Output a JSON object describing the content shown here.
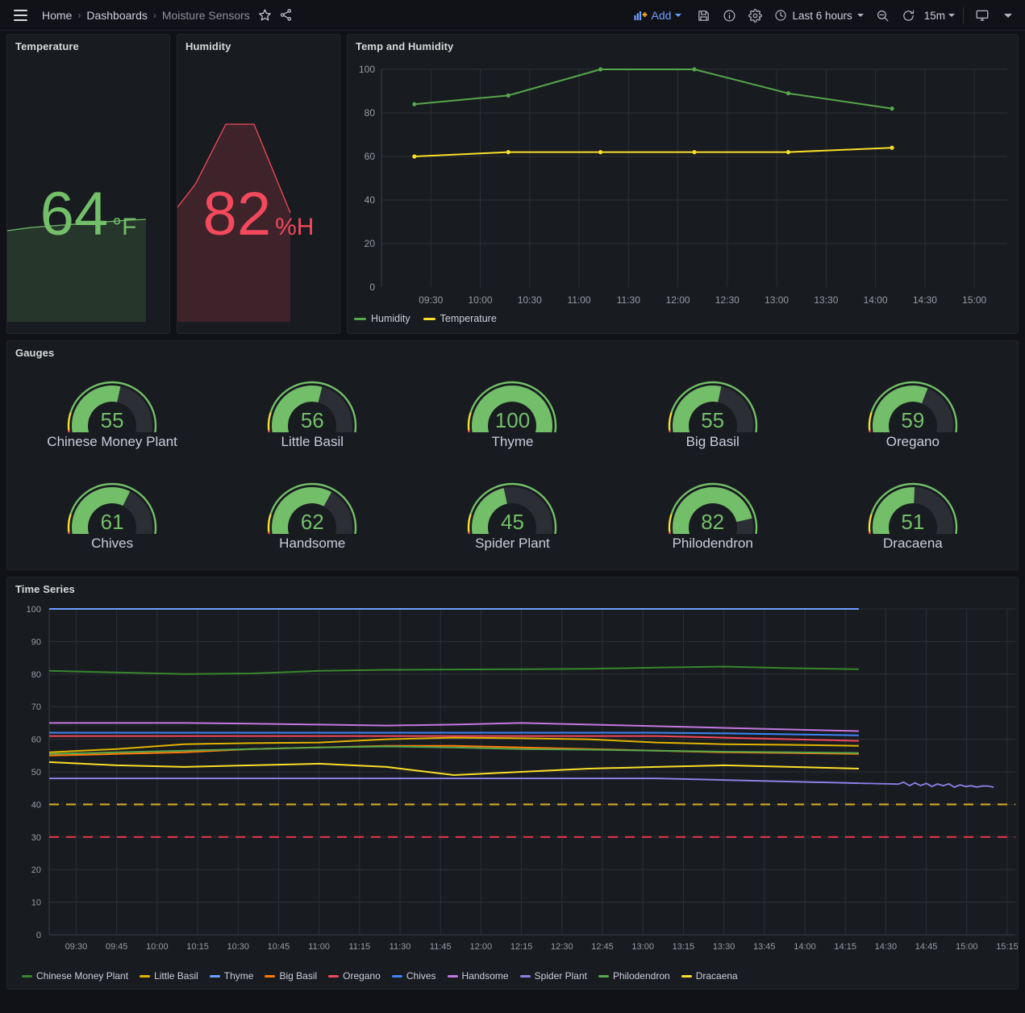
{
  "nav": {
    "menu_icon": "hamburger-icon",
    "breadcrumbs": [
      {
        "label": "Home",
        "current": false
      },
      {
        "label": "Dashboards",
        "current": false
      },
      {
        "label": "Moisture Sensors",
        "current": true
      }
    ],
    "star_icon": "star-icon",
    "share_icon": "share-icon"
  },
  "toolbar": {
    "add_label": "Add",
    "add_icon": "add-panel-icon",
    "add_color": "#6e9fff",
    "save_icon": "save-icon",
    "info_icon": "info-icon",
    "settings_icon": "gear-icon",
    "time_icon": "clock-icon",
    "time_range": "Last 6 hours",
    "zoom_out_icon": "zoom-out-icon",
    "refresh_icon": "refresh-icon",
    "refresh_interval": "15m",
    "kiosk_icon": "tv-icon",
    "chevron_icon": "chevron-down-icon"
  },
  "panels": {
    "temperature": {
      "title": "Temperature",
      "value": "64",
      "unit": "°F",
      "color": "#73bf69"
    },
    "humidity": {
      "title": "Humidity",
      "value": "82",
      "unit": "%H",
      "color": "#f2495c"
    },
    "temp_and_humidity": {
      "title": "Temp and Humidity"
    },
    "gauges": {
      "title": "Gauges"
    },
    "time_series": {
      "title": "Time Series"
    }
  },
  "gauges": [
    {
      "label": "Chinese Money Plant",
      "value": "55",
      "pct": 55
    },
    {
      "label": "Little Basil",
      "value": "56",
      "pct": 56
    },
    {
      "label": "Thyme",
      "value": "100",
      "pct": 100
    },
    {
      "label": "Big Basil",
      "value": "55",
      "pct": 55
    },
    {
      "label": "Oregano",
      "value": "59",
      "pct": 59
    },
    {
      "label": "Chives",
      "value": "61",
      "pct": 61
    },
    {
      "label": "Handsome",
      "value": "62",
      "pct": 62
    },
    {
      "label": "Spider Plant",
      "value": "45",
      "pct": 45
    },
    {
      "label": "Philodendron",
      "value": "82",
      "pct": 82
    },
    {
      "label": "Dracaena",
      "value": "51",
      "pct": 51
    }
  ],
  "chart_data": [
    {
      "id": "temp_and_humidity",
      "type": "line",
      "title": "Temp and Humidity",
      "xlabel": "",
      "ylabel": "",
      "ylim": [
        0,
        100
      ],
      "yticks": [
        0,
        20,
        40,
        60,
        80,
        100
      ],
      "xticks": [
        "09:30",
        "10:00",
        "10:30",
        "11:00",
        "11:30",
        "12:00",
        "12:30",
        "13:00",
        "13:30",
        "14:00",
        "14:30",
        "15:00"
      ],
      "x": [
        "09:20",
        "10:17",
        "11:13",
        "12:10",
        "13:07",
        "14:10"
      ],
      "grid": true,
      "legend_position": "bottom",
      "series": [
        {
          "name": "Humidity",
          "color": "#56a64b",
          "values": [
            84,
            88,
            100,
            100,
            89,
            82
          ]
        },
        {
          "name": "Temperature",
          "color": "#fade2a",
          "values": [
            60,
            62,
            62,
            62,
            62,
            64
          ]
        }
      ]
    },
    {
      "id": "time_series",
      "type": "line",
      "title": "Time Series",
      "xlabel": "",
      "ylabel": "",
      "ylim": [
        0,
        100
      ],
      "yticks": [
        0,
        10,
        20,
        30,
        40,
        50,
        60,
        70,
        80,
        90,
        100
      ],
      "xticks": [
        "09:30",
        "09:45",
        "10:00",
        "10:15",
        "10:30",
        "10:45",
        "11:00",
        "11:15",
        "11:30",
        "11:45",
        "12:00",
        "12:15",
        "12:30",
        "12:45",
        "13:00",
        "13:15",
        "13:30",
        "13:45",
        "14:00",
        "14:15",
        "14:30",
        "14:45",
        "15:00",
        "15:15"
      ],
      "grid": true,
      "legend_position": "bottom",
      "thresholds": [
        {
          "value": 40,
          "color": "#c9a227",
          "style": "dashed"
        },
        {
          "value": 30,
          "color": "#e0344b",
          "style": "dashed"
        }
      ],
      "series": [
        {
          "name": "Chinese Money Plant",
          "color": "#37872d",
          "values": [
            81,
            80.5,
            80,
            80.2,
            81,
            81.3,
            81.4,
            81.5,
            81.6,
            82,
            82.3,
            81.8,
            81.5
          ]
        },
        {
          "name": "Little Basil",
          "color": "#e0b400",
          "values": [
            56,
            57,
            58.5,
            58.8,
            59,
            60,
            60.5,
            60.3,
            60,
            59,
            58.5,
            58.3,
            58
          ]
        },
        {
          "name": "Thyme",
          "color": "#6e9fff",
          "values": [
            100,
            100,
            100,
            100,
            100,
            100,
            100,
            100,
            100,
            100,
            100,
            100,
            100
          ]
        },
        {
          "name": "Big Basil",
          "color": "#ff780a",
          "values": [
            55,
            55.5,
            56,
            57,
            57.5,
            58,
            58,
            57.5,
            57,
            56.5,
            56,
            55.8,
            55.5
          ]
        },
        {
          "name": "Oregano",
          "color": "#f2495c",
          "values": [
            61,
            61,
            61,
            61,
            61,
            61,
            61,
            61,
            61,
            61,
            60.5,
            60,
            59.5
          ]
        },
        {
          "name": "Chives",
          "color": "#3d85f7",
          "values": [
            62,
            62,
            62,
            62,
            62,
            62,
            62,
            62,
            62,
            62,
            61.8,
            61.5,
            61.2
          ]
        },
        {
          "name": "Handsome",
          "color": "#c377e0",
          "values": [
            65,
            65,
            65,
            64.8,
            64.5,
            64.2,
            64.5,
            65,
            64.5,
            64,
            63.5,
            63,
            62.5
          ]
        },
        {
          "name": "Spider Plant",
          "color": "#8f7fe8",
          "values": [
            48,
            48,
            48,
            48,
            48,
            48,
            48,
            48,
            48,
            48,
            47.5,
            47,
            46.5
          ]
        },
        {
          "name": "Philodendron",
          "color": "#56a64b",
          "values": [
            55.5,
            56,
            56.5,
            57,
            57.5,
            57.8,
            57.5,
            57,
            56.8,
            56.5,
            56.2,
            56,
            55.8
          ]
        },
        {
          "name": "Dracaena",
          "color": "#fade2a",
          "values": [
            53,
            52,
            51.5,
            52,
            52.5,
            51.5,
            49,
            50,
            51,
            51.5,
            52,
            51.5,
            51
          ]
        }
      ]
    }
  ]
}
